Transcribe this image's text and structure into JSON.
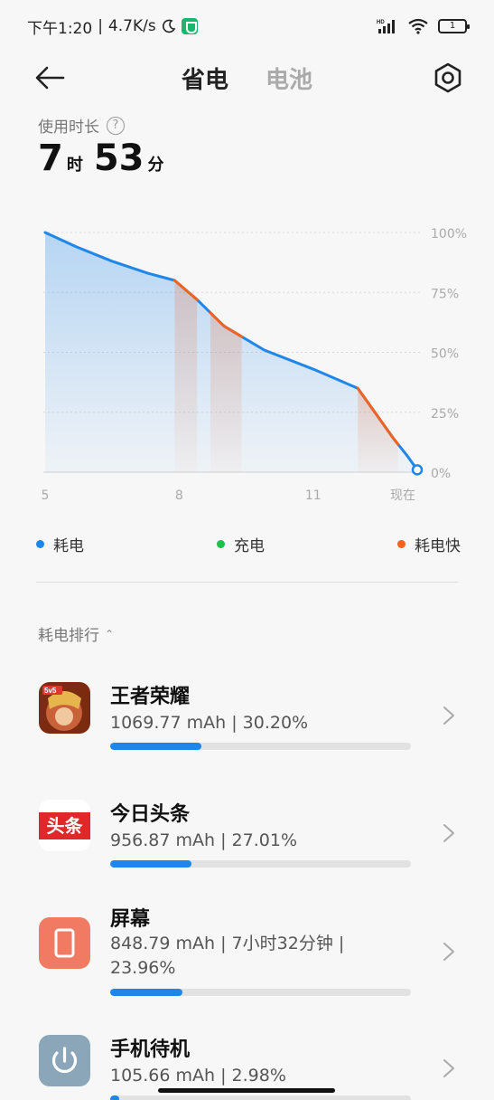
{
  "status_bar": {
    "time": "下午1:20",
    "speed": "4.7K/s",
    "battery_level": "1"
  },
  "header": {
    "tab_active": "省电",
    "tab_inactive": "电池"
  },
  "usage": {
    "label": "使用时长",
    "hours": "7",
    "hours_unit": "时",
    "minutes": "53",
    "minutes_unit": "分"
  },
  "chart_data": {
    "type": "area",
    "x_tick_labels": [
      "5",
      "8",
      "11",
      "现在"
    ],
    "y_tick_labels": [
      "100%",
      "75%",
      "50%",
      "25%",
      "0%"
    ],
    "ylim": [
      0,
      100
    ],
    "x_hours_range": [
      5,
      13.33
    ],
    "series": [
      {
        "name": "耗电",
        "color": "#1f86ea",
        "points": [
          [
            5.0,
            100
          ],
          [
            5.7,
            94
          ],
          [
            6.5,
            88
          ],
          [
            7.3,
            83
          ],
          [
            7.9,
            80
          ],
          [
            8.4,
            72
          ],
          [
            9.0,
            61
          ],
          [
            9.9,
            51
          ],
          [
            11.0,
            43
          ],
          [
            12.0,
            35
          ],
          [
            12.8,
            14
          ],
          [
            13.1,
            7
          ],
          [
            13.33,
            1
          ]
        ]
      }
    ],
    "fast_segments": [
      [
        7.9,
        8.4
      ],
      [
        8.7,
        9.4
      ],
      [
        12.0,
        12.9
      ]
    ],
    "fast_color": "#f06321",
    "grid": true
  },
  "legend": [
    {
      "label": "耗电",
      "color": "#1f86ea"
    },
    {
      "label": "充电",
      "color": "#1fbf4a"
    },
    {
      "label": "耗电快",
      "color": "#f06321"
    }
  ],
  "ranking": {
    "title": "耗电排行",
    "apps": [
      {
        "name": "王者荣耀",
        "detail": "1069.77 mAh | 30.20%",
        "percent": 30.2,
        "icon": "honor-of-kings-icon"
      },
      {
        "name": "今日头条",
        "detail": "956.87 mAh | 27.01%",
        "percent": 27.01,
        "icon": "toutiao-icon",
        "icon_text": "头条"
      },
      {
        "name": "屏幕",
        "detail": "848.79 mAh | 7小时32分钟 | 23.96%",
        "percent": 23.96,
        "icon": "phone-screen-icon"
      },
      {
        "name": "手机待机",
        "detail": "105.66 mAh | 2.98%",
        "percent": 2.98,
        "icon": "power-icon"
      }
    ]
  }
}
